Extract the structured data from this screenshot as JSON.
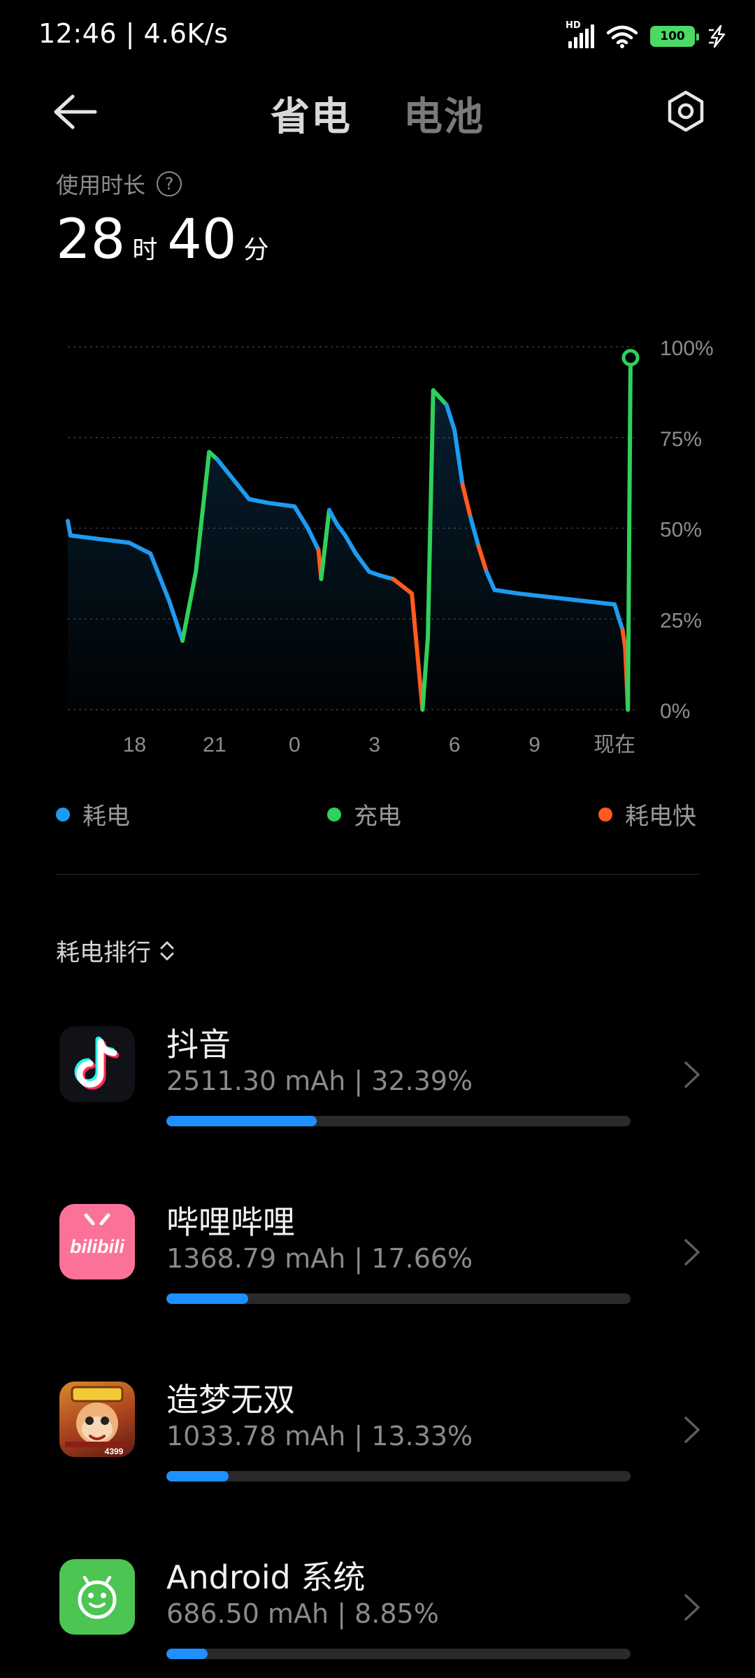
{
  "status_bar": {
    "time": "12:46 | 4.6K/s",
    "signal_badge": "HD",
    "battery": "100",
    "icons": [
      "hd-signal-icon",
      "wifi-icon",
      "battery-icon",
      "charging-icon"
    ]
  },
  "header": {
    "tabs": [
      {
        "label": "省电",
        "active": true
      },
      {
        "label": "电池",
        "active": false
      }
    ],
    "icons": [
      "back-arrow-icon",
      "settings-icon"
    ]
  },
  "usage": {
    "label": "使用时长",
    "hours": "28",
    "hours_unit": "时",
    "minutes": "40",
    "minutes_unit": "分"
  },
  "chart_data": {
    "type": "line",
    "y_ticks": [
      "100%",
      "75%",
      "50%",
      "25%",
      "0%"
    ],
    "x_ticks": [
      "18",
      "21",
      "0",
      "3",
      "6",
      "9",
      "现在"
    ],
    "ylim": [
      0,
      100
    ],
    "grid": true,
    "series": [
      {
        "name": "耗电",
        "color": "#1e9bf0"
      },
      {
        "name": "充电",
        "color": "#2fd15b"
      },
      {
        "name": "耗电快",
        "color": "#ff5a1f"
      }
    ],
    "x_hours": [
      15.5,
      15.6,
      17.8,
      18.6,
      19.3,
      19.8,
      20.3,
      20.8,
      21.1,
      22.3,
      23.0,
      24.0,
      24.5,
      24.9,
      25.0,
      25.3,
      25.6,
      25.9,
      26.3,
      26.8,
      27.2,
      27.7,
      28.4,
      28.8,
      29.0,
      29.2,
      29.7,
      30.0,
      30.3,
      30.6,
      30.9,
      31.2,
      31.5,
      32.4,
      36.0,
      36.3,
      36.4,
      36.5,
      36.6
    ],
    "y_values": [
      52,
      48,
      46,
      43,
      30,
      19,
      38,
      71,
      69,
      58,
      57,
      56,
      50,
      44,
      36,
      55,
      51,
      48,
      43,
      38,
      37,
      36,
      32,
      0,
      20,
      88,
      84,
      77,
      62,
      53,
      45,
      38,
      33,
      32,
      29,
      22,
      17,
      0,
      97
    ],
    "segment_types": [
      "耗电",
      "耗电",
      "耗电",
      "耗电",
      "耗电",
      "充电",
      "充电",
      "充电",
      "耗电",
      "耗电",
      "耗电",
      "耗电",
      "耗电",
      "耗电快",
      "充电",
      "耗电",
      "耗电",
      "耗电",
      "耗电",
      "耗电",
      "耗电",
      "耗电快",
      "耗电快",
      "充电",
      "充电",
      "充电",
      "耗电",
      "耗电",
      "耗电快",
      "耗电",
      "耗电快",
      "耗电",
      "耗电",
      "耗电",
      "耗电",
      "耗电快",
      "耗电快",
      "充电"
    ]
  },
  "legend": [
    {
      "label": "耗电",
      "color": "#1e9bf0"
    },
    {
      "label": "充电",
      "color": "#2fd15b"
    },
    {
      "label": "耗电快",
      "color": "#ff5a1f"
    }
  ],
  "ranking": {
    "title": "耗电排行",
    "apps": [
      {
        "name": "抖音",
        "stat": "2511.30 mAh | 32.39%",
        "fraction": 0.3239,
        "icon": "tiktok-icon"
      },
      {
        "name": "哔哩哔哩",
        "stat": "1368.79 mAh | 17.66%",
        "fraction": 0.1766,
        "icon": "bilibili-icon",
        "icon_text": "bilibili"
      },
      {
        "name": "造梦无双",
        "stat": "1033.78 mAh | 13.33%",
        "fraction": 0.1333,
        "icon": "game-icon",
        "icon_text": "4399"
      },
      {
        "name": "Android 系统",
        "stat": "686.50 mAh | 8.85%",
        "fraction": 0.0885,
        "icon": "android-icon"
      }
    ]
  }
}
